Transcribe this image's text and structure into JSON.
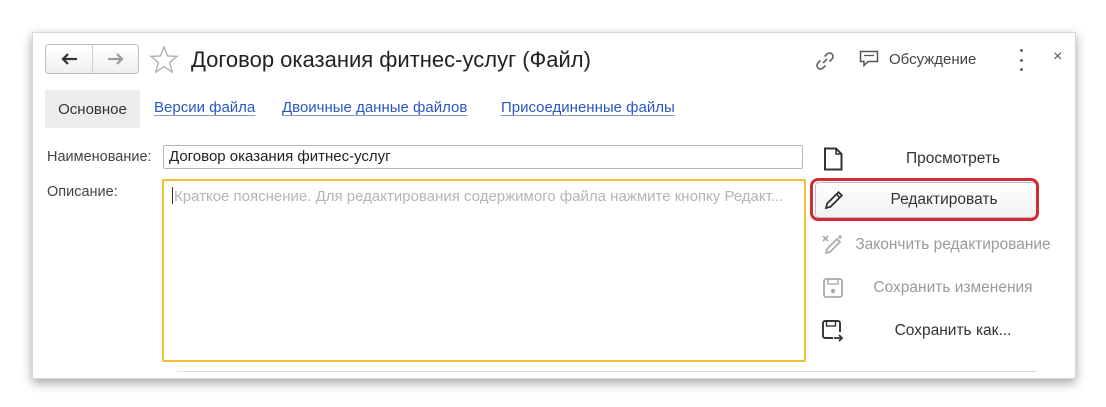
{
  "window": {
    "title": "Договор оказания фитнес-услуг (Файл)",
    "discussion_label": "Обсуждение",
    "close_glyph": "×"
  },
  "tabs": {
    "main": "Основное",
    "versions": "Версии файла",
    "binary": "Двоичные данные файлов",
    "attached": "Присоединенные файлы"
  },
  "form": {
    "name_label": "Наименование:",
    "name_value": "Договор оказания фитнес-услуг",
    "desc_label": "Описание:",
    "desc_placeholder": "Краткое пояснение. Для редактирования содержимого файла нажмите кнопку Редакт..."
  },
  "commands": {
    "view": "Просмотреть",
    "edit": "Редактировать",
    "finish_edit": "Закончить редактирование",
    "save_changes": "Сохранить изменения",
    "save_as": "Сохранить как..."
  },
  "colors": {
    "link": "#2a58c2",
    "focus_border": "#f0c030",
    "highlight": "#d42a35"
  },
  "icons": [
    "back-arrow-icon",
    "forward-arrow-icon",
    "star-icon",
    "link-icon",
    "discussion-icon",
    "more-icon",
    "close-icon",
    "document-icon",
    "pencil-icon",
    "finish-edit-icon",
    "save-icon",
    "save-as-icon"
  ]
}
